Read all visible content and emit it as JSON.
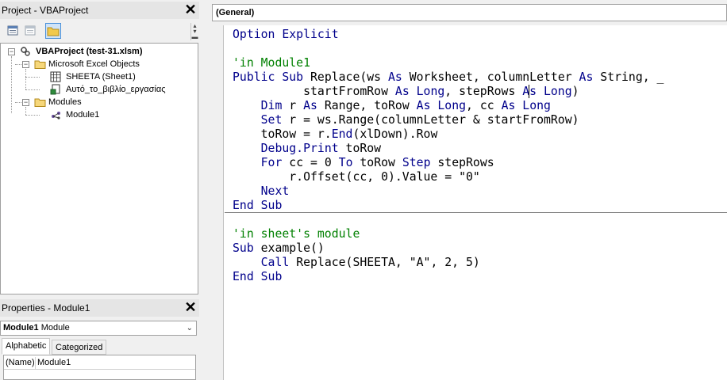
{
  "project_pane": {
    "title": "Project - VBAProject",
    "close_glyph": "✕",
    "toolbar": [
      "view-code-icon",
      "view-object-icon",
      "toggle-folders-icon"
    ],
    "tree": {
      "root": "VBAProject (test-31.xlsm)",
      "folders": [
        {
          "label": "Microsoft Excel Objects",
          "items": [
            "SHEETA (Sheet1)",
            "Αυτό_το_βιβλίο_εργασίας"
          ]
        },
        {
          "label": "Modules",
          "items": [
            "Module1"
          ]
        }
      ],
      "expander_glyph": "−"
    }
  },
  "properties_pane": {
    "title": "Properties - Module1",
    "close_glyph": "✕",
    "object_name": "Module1",
    "object_type": "Module",
    "chevron": "⌄",
    "tabs": [
      "Alphabetic",
      "Categorized"
    ],
    "rows": [
      {
        "name": "(Name)",
        "value": "Module1"
      }
    ]
  },
  "code_window": {
    "object_combo": "(General)",
    "lines": [
      [
        {
          "t": "Option Explicit",
          "c": "kw"
        }
      ],
      [],
      [
        {
          "t": "'in Module1",
          "c": "cm"
        }
      ],
      [
        {
          "t": "Public Sub ",
          "c": "kw"
        },
        {
          "t": "Replace(ws "
        },
        {
          "t": "As",
          "c": "kw"
        },
        {
          "t": " Worksheet, columnLetter "
        },
        {
          "t": "As",
          "c": "kw"
        },
        {
          "t": " String, _"
        }
      ],
      [
        {
          "t": "          startFromRow "
        },
        {
          "t": "As Long",
          "c": "kw"
        },
        {
          "t": ", stepRows "
        },
        {
          "t": "As Long",
          "c": "kw"
        },
        {
          "t": ")"
        }
      ],
      [
        {
          "t": "    "
        },
        {
          "t": "Dim",
          "c": "kw"
        },
        {
          "t": " r "
        },
        {
          "t": "As",
          "c": "kw"
        },
        {
          "t": " Range, toRow "
        },
        {
          "t": "As Long",
          "c": "kw"
        },
        {
          "t": ", cc "
        },
        {
          "t": "As Long",
          "c": "kw"
        }
      ],
      [
        {
          "t": "    "
        },
        {
          "t": "Set",
          "c": "kw"
        },
        {
          "t": " r = ws.Range(columnLetter & startFromRow)"
        }
      ],
      [
        {
          "t": "    toRow = r."
        },
        {
          "t": "End",
          "c": "kw"
        },
        {
          "t": "(xlDown).Row"
        }
      ],
      [
        {
          "t": "    "
        },
        {
          "t": "Debug.Print",
          "c": "kw"
        },
        {
          "t": " toRow"
        }
      ],
      [
        {
          "t": "    "
        },
        {
          "t": "For",
          "c": "kw"
        },
        {
          "t": " cc = 0 "
        },
        {
          "t": "To",
          "c": "kw"
        },
        {
          "t": " toRow "
        },
        {
          "t": "Step",
          "c": "kw"
        },
        {
          "t": " stepRows"
        }
      ],
      [
        {
          "t": "        r.Offset(cc, 0).Value = \"0\""
        }
      ],
      [
        {
          "t": "    "
        },
        {
          "t": "Next",
          "c": "kw"
        }
      ],
      [
        {
          "t": "End Sub",
          "c": "kw"
        }
      ],
      [],
      [
        {
          "t": "'in sheet's module",
          "c": "cm"
        }
      ],
      [
        {
          "t": "Sub",
          "c": "kw"
        },
        {
          "t": " example()"
        }
      ],
      [
        {
          "t": "    "
        },
        {
          "t": "Call",
          "c": "kw"
        },
        {
          "t": " Replace(SHEETA, \"A\", 2, 5)"
        }
      ],
      [
        {
          "t": "End Sub",
          "c": "kw"
        }
      ]
    ]
  }
}
